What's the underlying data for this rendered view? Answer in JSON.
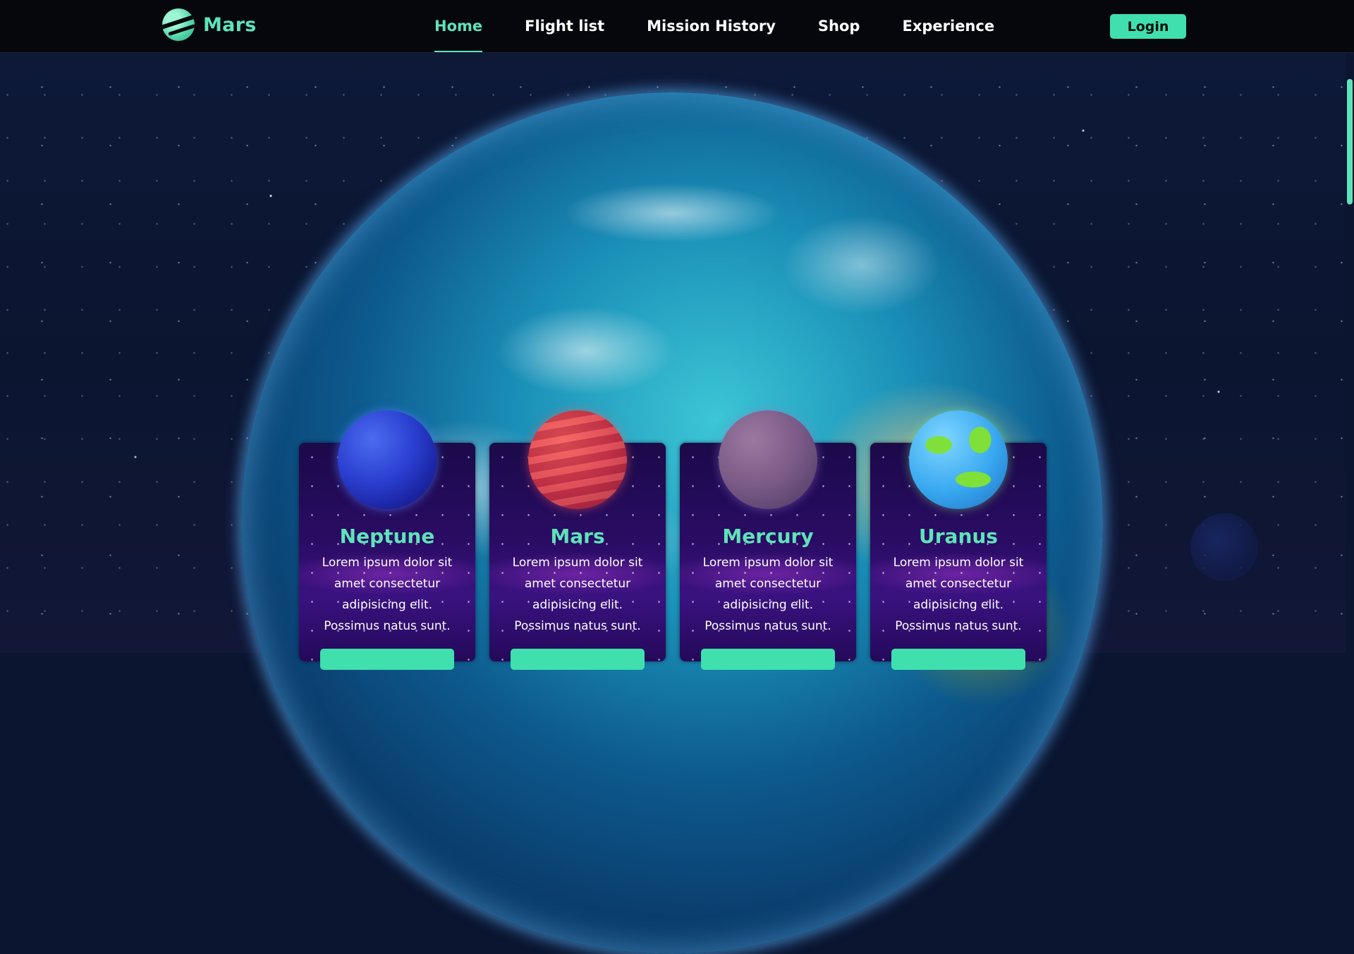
{
  "brand": {
    "name": "Mars"
  },
  "nav": {
    "items": [
      {
        "label": "Home",
        "active": true
      },
      {
        "label": "Flight list",
        "active": false
      },
      {
        "label": "Mission History",
        "active": false
      },
      {
        "label": "Shop",
        "active": false
      },
      {
        "label": "Experience",
        "active": false
      }
    ]
  },
  "auth": {
    "login_label": "Login"
  },
  "colors": {
    "accent": "#3fe0ad",
    "nav_bg": "#05070d",
    "page_bg": "#0b1530"
  },
  "cards": [
    {
      "title": "Neptune",
      "text": "Lorem ipsum dolor sit amet consectetur adipisicing elit. Possimus natus sunt.",
      "planet_icon": "neptune-planet-icon"
    },
    {
      "title": "Mars",
      "text": "Lorem ipsum dolor sit amet consectetur adipisicing elit. Possimus natus sunt.",
      "planet_icon": "mars-planet-icon"
    },
    {
      "title": "Mercury",
      "text": "Lorem ipsum dolor sit amet consectetur adipisicing elit. Possimus natus sunt.",
      "planet_icon": "mercury-planet-icon"
    },
    {
      "title": "Uranus",
      "text": "Lorem ipsum dolor sit amet consectetur adipisicing elit. Possimus natus sunt.",
      "planet_icon": "uranus-planet-icon"
    }
  ]
}
